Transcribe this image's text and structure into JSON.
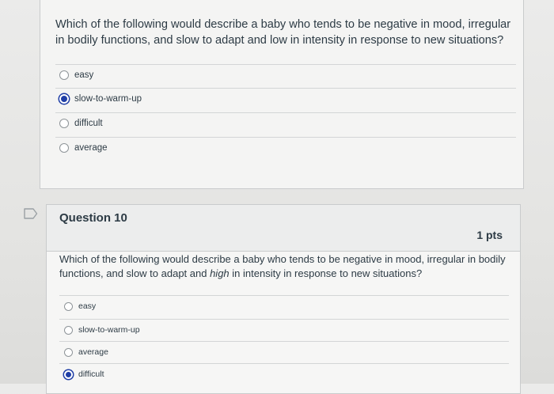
{
  "question9": {
    "text": "Which of the following would describe a baby who tends to be negative in mood, irregular in bodily functions, and slow to adapt and low in intensity in response to new situations?",
    "answers": [
      {
        "label": "easy",
        "selected": false
      },
      {
        "label": "slow-to-warm-up",
        "selected": true
      },
      {
        "label": "difficult",
        "selected": false
      },
      {
        "label": "average",
        "selected": false
      }
    ]
  },
  "question10": {
    "title": "Question 10",
    "points": "1 pts",
    "text_before": "Which of the following would describe a baby who tends to be negative in mood, irregular in bodily functions, and slow to adapt and ",
    "text_emphasis": "high",
    "text_after": " in intensity in response to new situations?",
    "answers": [
      {
        "label": "easy",
        "selected": false
      },
      {
        "label": "slow-to-warm-up",
        "selected": false
      },
      {
        "label": "average",
        "selected": false
      },
      {
        "label": "difficult",
        "selected": true
      }
    ]
  },
  "colors": {
    "selected_radio": "#1f3ea6",
    "text": "#2d3b45"
  },
  "icons": {
    "bookmark": "bookmark-flag-icon"
  }
}
